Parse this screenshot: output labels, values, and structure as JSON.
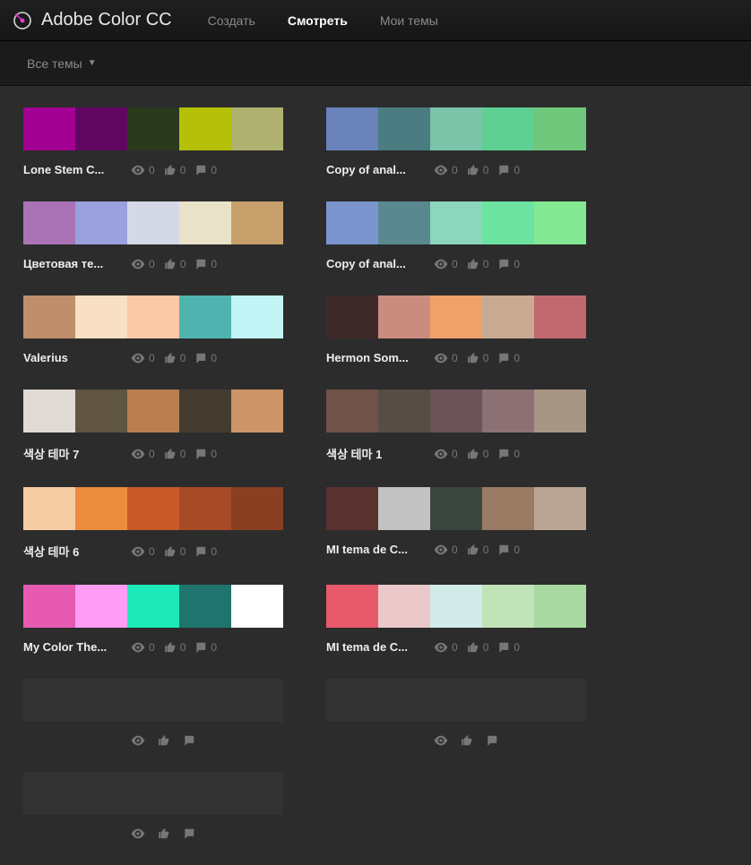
{
  "header": {
    "app_title": "Adobe Color CC",
    "tabs": {
      "create": "Создать",
      "view": "Смотреть",
      "my_themes": "Мои темы"
    }
  },
  "filter": {
    "label": "Все темы"
  },
  "themes": [
    {
      "title": "Lone Stem C...",
      "colors": [
        "#a20092",
        "#5e0660",
        "#2a3a1c",
        "#b4c108",
        "#b0b271"
      ],
      "views": "0",
      "likes": "0",
      "comments": "0"
    },
    {
      "title": "Copy of anal...",
      "colors": [
        "#6a84bb",
        "#4a7c81",
        "#7bc3a9",
        "#5fcf93",
        "#6fc77c"
      ],
      "views": "0",
      "likes": "0",
      "comments": "0"
    },
    {
      "title": "Цветовая те...",
      "colors": [
        "#a973b6",
        "#9aa1dc",
        "#d5d8e7",
        "#eae2c8",
        "#c69f6b"
      ],
      "views": "0",
      "likes": "0",
      "comments": "0"
    },
    {
      "title": "Copy of anal...",
      "colors": [
        "#7a95cd",
        "#59898f",
        "#8cd6bd",
        "#6de3a2",
        "#82e892"
      ],
      "views": "0",
      "likes": "0",
      "comments": "0"
    },
    {
      "title": "Valerius",
      "colors": [
        "#bf8f6c",
        "#f9e0c5",
        "#fcc9a7",
        "#4fb4b0",
        "#c2f4f6"
      ],
      "views": "0",
      "likes": "0",
      "comments": "0"
    },
    {
      "title": "Hermon Som...",
      "colors": [
        "#3c2b28",
        "#cb8c80",
        "#eea269",
        "#c8aa92",
        "#c0686f"
      ],
      "views": "0",
      "likes": "0",
      "comments": "0"
    },
    {
      "title": "색상 테마 7",
      "colors": [
        "#e0dad4",
        "#5f5541",
        "#ba7f4e",
        "#443b31",
        "#cd9567"
      ],
      "views": "0",
      "likes": "0",
      "comments": "0"
    },
    {
      "title": "색상 테마 1",
      "colors": [
        "#6f5248",
        "#564d45",
        "#6b5359",
        "#8b7173",
        "#a79684"
      ],
      "views": "0",
      "likes": "0",
      "comments": "0"
    },
    {
      "title": "색상 테마 6",
      "colors": [
        "#f5cca4",
        "#eb8b3e",
        "#c85a2a",
        "#a74a26",
        "#8b3f22"
      ],
      "views": "0",
      "likes": "0",
      "comments": "0"
    },
    {
      "title": "MI tema de C...",
      "colors": [
        "#5a322f",
        "#c2c2c2",
        "#3a4740",
        "#987b62",
        "#b9a594"
      ],
      "views": "0",
      "likes": "0",
      "comments": "0"
    },
    {
      "title": "My Color The...",
      "colors": [
        "#e65bb1",
        "#ff9cf3",
        "#1de8b8",
        "#20746e",
        "#ffffff"
      ],
      "views": "0",
      "likes": "0",
      "comments": "0"
    },
    {
      "title": "MI tema de C...",
      "colors": [
        "#e75a6c",
        "#ebc8c9",
        "#d2ebe8",
        "#c0e4b8",
        "#a8d9a1"
      ],
      "views": "0",
      "likes": "0",
      "comments": "0"
    },
    {
      "title": "",
      "colors": [
        "#333",
        "#333",
        "#333",
        "#333",
        "#333"
      ],
      "views": "",
      "likes": "",
      "comments": ""
    },
    {
      "title": "",
      "colors": [
        "#333",
        "#333",
        "#333",
        "#333",
        "#333"
      ],
      "views": "",
      "likes": "",
      "comments": ""
    },
    {
      "title": "",
      "colors": [
        "#333",
        "#333",
        "#333",
        "#333",
        "#333"
      ],
      "views": "",
      "likes": "",
      "comments": ""
    }
  ]
}
